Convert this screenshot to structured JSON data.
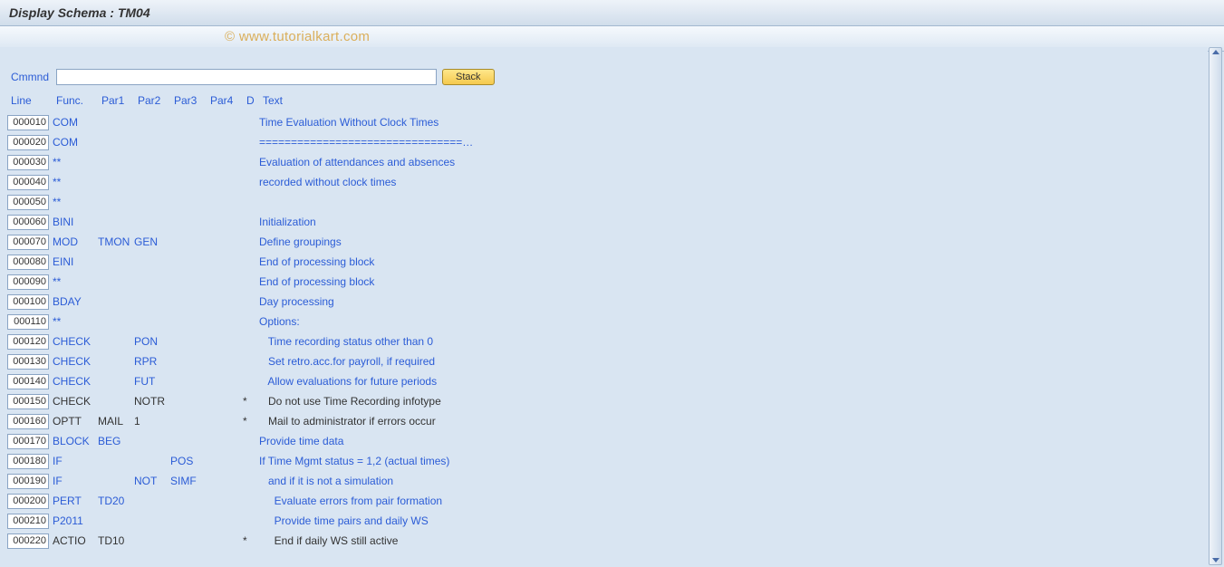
{
  "title": "Display Schema : TM04",
  "watermark": "© www.tutorialkart.com",
  "cmd": {
    "label": "Cmmnd",
    "value": "",
    "stack_btn": "Stack"
  },
  "headers": {
    "line": "Line",
    "func": "Func.",
    "par1": "Par1",
    "par2": "Par2",
    "par3": "Par3",
    "par4": "Par4",
    "d": "D",
    "text": "Text"
  },
  "rows": [
    {
      "line": "000010",
      "func": "COM",
      "par1": "",
      "par2": "",
      "par3": "",
      "par4": "",
      "d": "",
      "text": "Time Evaluation Without Clock Times",
      "link": true
    },
    {
      "line": "000020",
      "func": "COM",
      "par1": "",
      "par2": "",
      "par3": "",
      "par4": "",
      "d": "",
      "text": "================================…",
      "link": true
    },
    {
      "line": "000030",
      "func": "**",
      "par1": "",
      "par2": "",
      "par3": "",
      "par4": "",
      "d": "",
      "text": "Evaluation of attendances and absences",
      "link": true
    },
    {
      "line": "000040",
      "func": "**",
      "par1": "",
      "par2": "",
      "par3": "",
      "par4": "",
      "d": "",
      "text": "recorded without clock times",
      "link": true
    },
    {
      "line": "000050",
      "func": "**",
      "par1": "",
      "par2": "",
      "par3": "",
      "par4": "",
      "d": "",
      "text": "",
      "link": true
    },
    {
      "line": "000060",
      "func": "BINI",
      "par1": "",
      "par2": "",
      "par3": "",
      "par4": "",
      "d": "",
      "text": "Initialization",
      "link": true
    },
    {
      "line": "000070",
      "func": "MOD",
      "par1": "TMON",
      "par2": "GEN",
      "par3": "",
      "par4": "",
      "d": "",
      "text": "Define groupings",
      "link": true
    },
    {
      "line": "000080",
      "func": "EINI",
      "par1": "",
      "par2": "",
      "par3": "",
      "par4": "",
      "d": "",
      "text": "End of processing block",
      "link": true
    },
    {
      "line": "000090",
      "func": "**",
      "par1": "",
      "par2": "",
      "par3": "",
      "par4": "",
      "d": "",
      "text": "End of processing block",
      "link": true
    },
    {
      "line": "000100",
      "func": "BDAY",
      "par1": "",
      "par2": "",
      "par3": "",
      "par4": "",
      "d": "",
      "text": "Day processing",
      "link": true
    },
    {
      "line": "000110",
      "func": "**",
      "par1": "",
      "par2": "",
      "par3": "",
      "par4": "",
      "d": "",
      "text": "Options:",
      "link": true
    },
    {
      "line": "000120",
      "func": "CHECK",
      "par1": "",
      "par2": "PON",
      "par3": "",
      "par4": "",
      "d": "",
      "text": "   Time recording status other than 0",
      "link": true
    },
    {
      "line": "000130",
      "func": "CHECK",
      "par1": "",
      "par2": "RPR",
      "par3": "",
      "par4": "",
      "d": "",
      "text": "   Set retro.acc.for payroll, if required",
      "link": true
    },
    {
      "line": "000140",
      "func": "CHECK",
      "par1": "",
      "par2": "FUT",
      "par3": "",
      "par4": "",
      "d": "",
      "text": "   Allow evaluations for future periods",
      "link": true
    },
    {
      "line": "000150",
      "func": "CHECK",
      "par1": "",
      "par2": "NOTR",
      "par3": "",
      "par4": "",
      "d": "*",
      "text": "   Do not use Time Recording infotype",
      "link": false
    },
    {
      "line": "000160",
      "func": "OPTT",
      "par1": "MAIL",
      "par2": "1",
      "par3": "",
      "par4": "",
      "d": "*",
      "text": "   Mail to administrator if errors occur",
      "link": false
    },
    {
      "line": "000170",
      "func": "BLOCK",
      "par1": "BEG",
      "par2": "",
      "par3": "",
      "par4": "",
      "d": "",
      "text": "Provide time data",
      "link": true
    },
    {
      "line": "000180",
      "func": "IF",
      "par1": "",
      "par2": "",
      "par3": "POS",
      "par4": "",
      "d": "",
      "text": "If Time Mgmt status = 1,2 (actual times)",
      "link": true
    },
    {
      "line": "000190",
      "func": "IF",
      "par1": "",
      "par2": "NOT",
      "par3": "SIMF",
      "par4": "",
      "d": "",
      "text": "   and if it is not a simulation",
      "link": true
    },
    {
      "line": "000200",
      "func": "PERT",
      "par1": "TD20",
      "par2": "",
      "par3": "",
      "par4": "",
      "d": "",
      "text": "     Evaluate errors from pair formation",
      "link": true
    },
    {
      "line": "000210",
      "func": "P2011",
      "par1": "",
      "par2": "",
      "par3": "",
      "par4": "",
      "d": "",
      "text": "     Provide time pairs and daily WS",
      "link": true
    },
    {
      "line": "000220",
      "func": "ACTIO",
      "par1": "TD10",
      "par2": "",
      "par3": "",
      "par4": "",
      "d": "*",
      "text": "     End if daily WS still active",
      "link": false
    }
  ]
}
